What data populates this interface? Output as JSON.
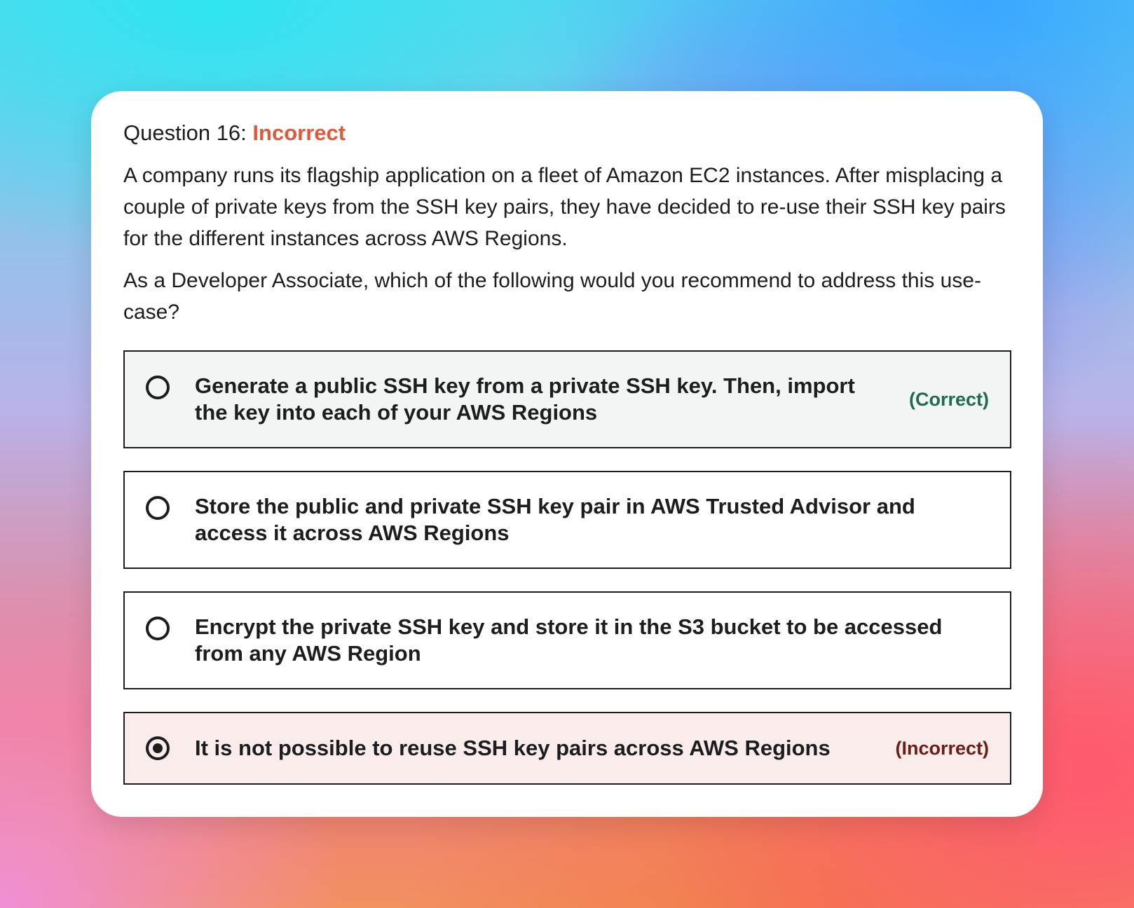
{
  "question": {
    "label": "Question 16:",
    "status": "Incorrect",
    "paragraphs": [
      "A company runs its flagship application on a fleet of Amazon EC2 instances. After misplacing a couple of private keys from the SSH key pairs, they have decided to re-use their SSH key pairs for the different instances across AWS Regions.",
      "As a Developer Associate, which of the following would you recommend to address this use-case?"
    ]
  },
  "options": [
    {
      "text": "Generate a public SSH key from a private SSH key. Then, import the key into each of your AWS Regions",
      "verdict": "(Correct)",
      "selected": false
    },
    {
      "text": "Store the public and private SSH key pair in AWS Trusted Advisor and access it across AWS Regions",
      "verdict": "",
      "selected": false
    },
    {
      "text": "Encrypt the private SSH key and store it in the S3 bucket to be accessed from any AWS Region",
      "verdict": "",
      "selected": false
    },
    {
      "text": "It is not possible to reuse SSH key pairs across AWS Regions",
      "verdict": "(Incorrect)",
      "selected": true
    }
  ],
  "colors": {
    "status_incorrect": "#e0593a",
    "correct_bg": "#f2f5f4",
    "correct_text": "#1e6b52",
    "incorrect_bg": "#faeceb",
    "incorrect_text": "#6b1c13"
  }
}
